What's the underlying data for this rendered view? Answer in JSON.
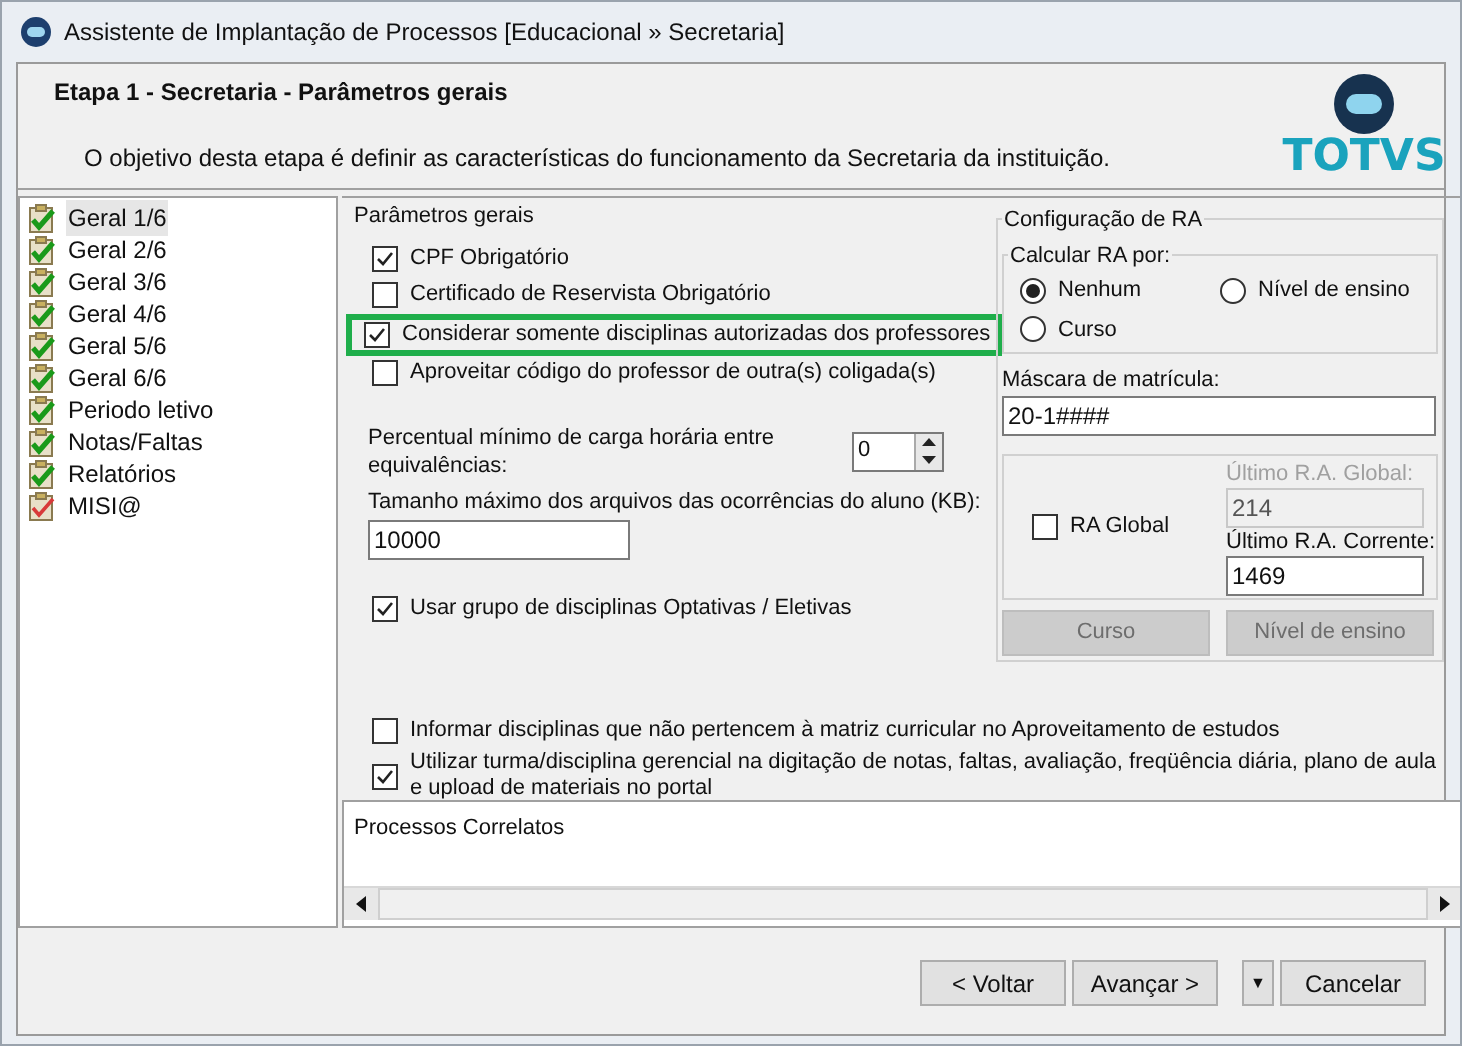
{
  "window": {
    "title": "Assistente de Implantação de Processos [Educacional » Secretaria]"
  },
  "header": {
    "title": "Etapa 1 - Secretaria - Parâmetros gerais",
    "description": "O objetivo desta etapa é definir as características do funcionamento da Secretaria da instituição.",
    "logo_text": "TOTVS"
  },
  "sidebar": {
    "items": [
      {
        "label": "Geral 1/6",
        "complete": true,
        "selected": true
      },
      {
        "label": "Geral 2/6",
        "complete": true,
        "selected": false
      },
      {
        "label": "Geral 3/6",
        "complete": true,
        "selected": false
      },
      {
        "label": "Geral 4/6",
        "complete": true,
        "selected": false
      },
      {
        "label": "Geral 5/6",
        "complete": true,
        "selected": false
      },
      {
        "label": "Geral 6/6",
        "complete": true,
        "selected": false
      },
      {
        "label": "Periodo letivo",
        "complete": true,
        "selected": false
      },
      {
        "label": "Notas/Faltas",
        "complete": true,
        "selected": false
      },
      {
        "label": "Relatórios",
        "complete": true,
        "selected": false
      },
      {
        "label": "MISI@",
        "complete": false,
        "selected": false
      }
    ]
  },
  "general_params": {
    "title": "Parâmetros gerais",
    "checkboxes": [
      {
        "label": "CPF Obrigatório",
        "checked": true,
        "highlighted": false
      },
      {
        "label": "Certificado de Reservista Obrigatório",
        "checked": false,
        "highlighted": false
      },
      {
        "label": "Considerar somente disciplinas autorizadas dos professores",
        "checked": true,
        "highlighted": true
      },
      {
        "label": "Aproveitar código do professor de outra(s) coligada(s)",
        "checked": false,
        "highlighted": false
      }
    ],
    "min_percent": {
      "label": "Percentual mínimo de carga horária entre equivalências:",
      "value": "0"
    },
    "max_file_size": {
      "label": "Tamanho máximo dos arquivos das ocorrências do aluno (KB):",
      "value": "10000"
    },
    "group_checkbox": {
      "label": "Usar grupo de disciplinas Optativas / Eletivas",
      "checked": true
    }
  },
  "ra_config": {
    "title": "Configuração de RA",
    "calc": {
      "title": "Calcular RA por:",
      "options": [
        {
          "label": "Nenhum",
          "selected": true
        },
        {
          "label": "Nível de ensino",
          "selected": false
        },
        {
          "label": "Curso",
          "selected": false
        }
      ]
    },
    "mask": {
      "label": "Máscara de matrícula:",
      "value": "20-1####"
    },
    "ra_global": {
      "label": "RA Global",
      "checked": false
    },
    "last_global": {
      "label": "Último R.A. Global:",
      "value": "214",
      "disabled": true
    },
    "last_current": {
      "label": "Último R.A. Corrente:",
      "value": "1469",
      "disabled": false
    },
    "buttons": [
      {
        "label": "Curso",
        "disabled": true
      },
      {
        "label": "Nível de ensino",
        "disabled": true
      }
    ]
  },
  "bottom_options": [
    {
      "label": "Informar disciplinas que não pertencem à matriz curricular no Aproveitamento de estudos",
      "checked": false
    },
    {
      "label": "Utilizar turma/disciplina gerencial na digitação de notas, faltas, avaliação, freqüência diária, plano de aula e upload de materiais no portal",
      "checked": true
    }
  ],
  "related": {
    "title": "Processos Correlatos"
  },
  "footer": {
    "buttons": [
      {
        "label": "< Voltar",
        "kind": "button"
      },
      {
        "label": "Avançar >",
        "kind": "button"
      },
      {
        "label": "▼",
        "kind": "dropdown"
      },
      {
        "label": "Cancelar",
        "kind": "button"
      }
    ]
  }
}
